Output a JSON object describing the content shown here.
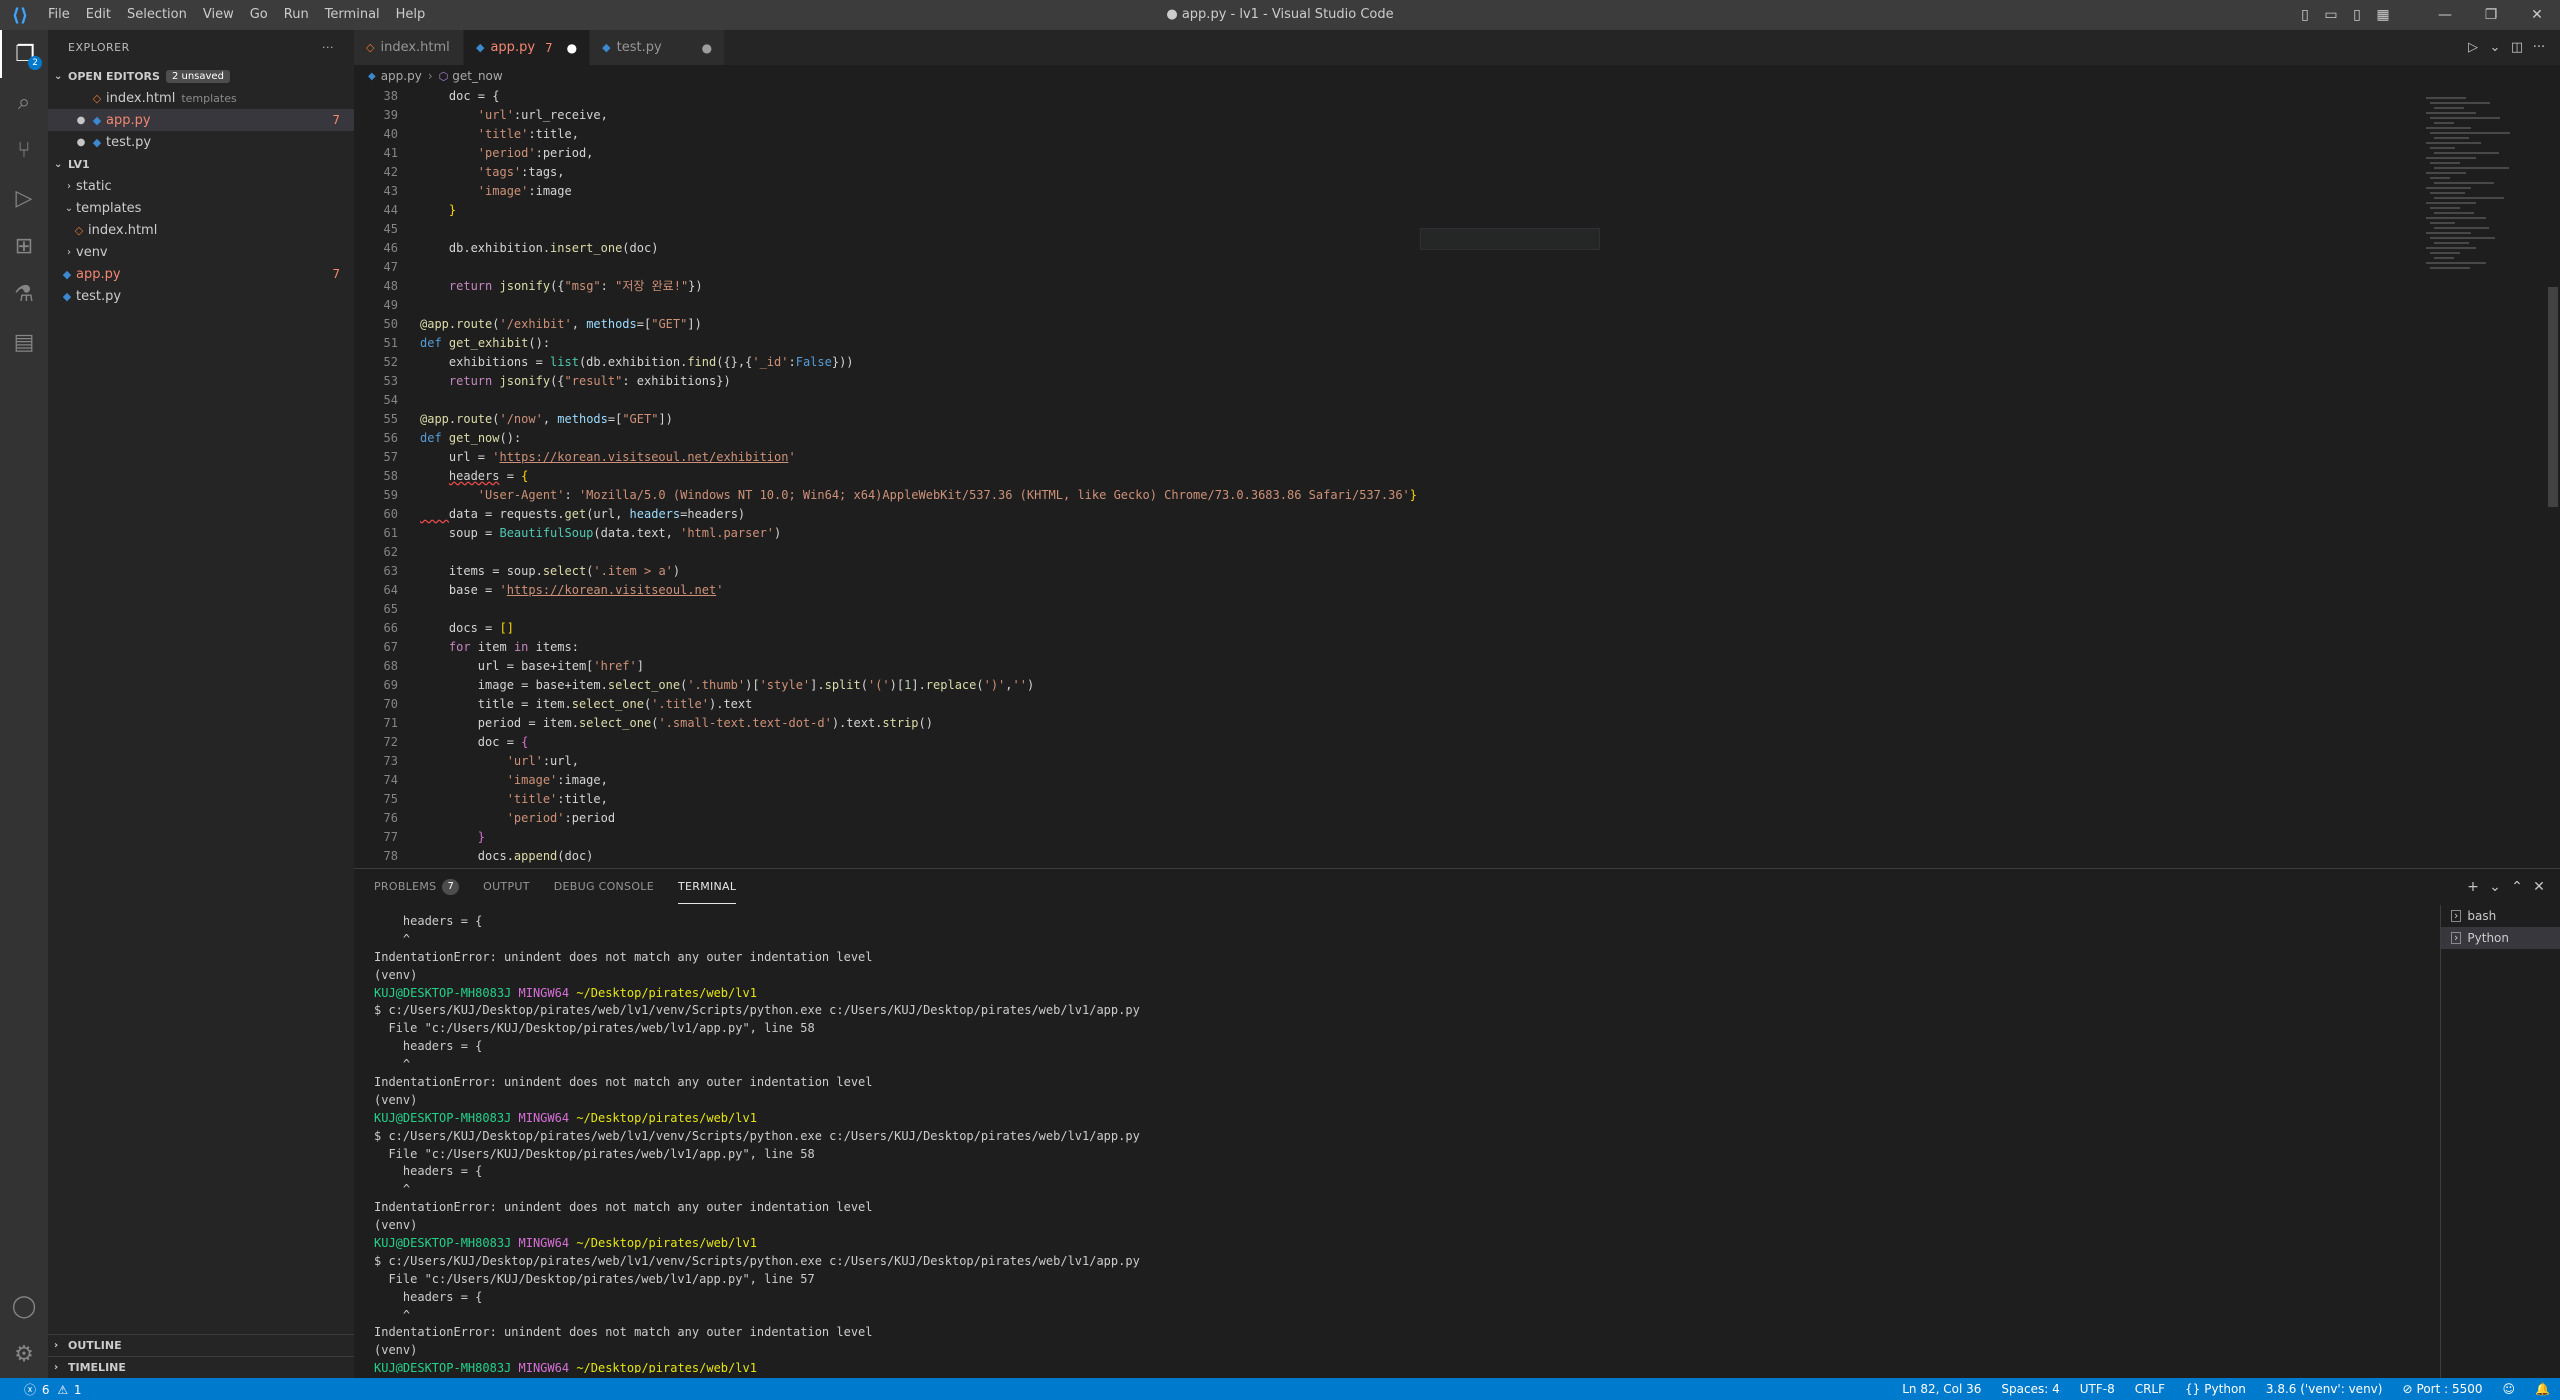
{
  "window": {
    "title": "● app.py - lv1 - Visual Studio Code",
    "menu": [
      "File",
      "Edit",
      "Selection",
      "View",
      "Go",
      "Run",
      "Terminal",
      "Help"
    ]
  },
  "activity_bar": {
    "explorer_badge": "2"
  },
  "sidebar": {
    "title": "EXPLORER",
    "open_editors": {
      "label": "OPEN EDITORS",
      "unsaved": "2 unsaved",
      "items": [
        {
          "name": "index.html",
          "desc": "templates",
          "count": ""
        },
        {
          "name": "app.py",
          "desc": "",
          "count": "7"
        },
        {
          "name": "test.py",
          "desc": "",
          "count": ""
        }
      ]
    },
    "folder": {
      "label": "LV1",
      "items": [
        {
          "name": "static",
          "count": ""
        },
        {
          "name": "templates",
          "count": ""
        },
        {
          "name": "index.html",
          "count": ""
        },
        {
          "name": "venv",
          "count": ""
        },
        {
          "name": "app.py",
          "count": "7"
        },
        {
          "name": "test.py",
          "count": ""
        }
      ]
    },
    "outline": "OUTLINE",
    "timeline": "TIMELINE"
  },
  "tabs": [
    {
      "label": "index.html",
      "count": ""
    },
    {
      "label": "app.py",
      "count": "7"
    },
    {
      "label": "test.py",
      "count": ""
    }
  ],
  "breadcrumb": {
    "file": "app.py",
    "symbol": "get_now"
  },
  "editor": {
    "line_numbers": [
      "38",
      "39",
      "40",
      "41",
      "42",
      "43",
      "44",
      "45",
      "46",
      "47",
      "48",
      "49",
      "50",
      "51",
      "52",
      "53",
      "54",
      "55",
      "56",
      "57",
      "58",
      "59",
      "60",
      "61",
      "62",
      "63",
      "64",
      "65",
      "66",
      "67",
      "68",
      "69",
      "70",
      "71",
      "72",
      "73",
      "74",
      "75",
      "76",
      "77",
      "78"
    ]
  },
  "panel": {
    "tabs": [
      {
        "label": "PROBLEMS",
        "badge": "7"
      },
      {
        "label": "OUTPUT",
        "badge": ""
      },
      {
        "label": "DEBUG CONSOLE",
        "badge": ""
      },
      {
        "label": "TERMINAL",
        "badge": ""
      }
    ],
    "terminals": [
      "bash",
      "Python"
    ],
    "terminal_lines": [
      "    headers = {",
      "    ^",
      "IndentationError: unindent does not match any outer indentation level",
      "(venv)",
      "KUJ@DESKTOP-MH8083J MINGW64 ~/Desktop/pirates/web/lv1",
      "$ c:/Users/KUJ/Desktop/pirates/web/lv1/venv/Scripts/python.exe c:/Users/KUJ/Desktop/pirates/web/lv1/app.py",
      "  File \"c:/Users/KUJ/Desktop/pirates/web/lv1/app.py\", line 58",
      "    headers = {",
      "    ^",
      "IndentationError: unindent does not match any outer indentation level",
      "(venv)",
      "KUJ@DESKTOP-MH8083J MINGW64 ~/Desktop/pirates/web/lv1",
      "$ c:/Users/KUJ/Desktop/pirates/web/lv1/venv/Scripts/python.exe c:/Users/KUJ/Desktop/pirates/web/lv1/app.py",
      "  File \"c:/Users/KUJ/Desktop/pirates/web/lv1/app.py\", line 58",
      "    headers = {",
      "    ^",
      "IndentationError: unindent does not match any outer indentation level",
      "(venv)",
      "KUJ@DESKTOP-MH8083J MINGW64 ~/Desktop/pirates/web/lv1",
      "$ c:/Users/KUJ/Desktop/pirates/web/lv1/venv/Scripts/python.exe c:/Users/KUJ/Desktop/pirates/web/lv1/app.py",
      "  File \"c:/Users/KUJ/Desktop/pirates/web/lv1/app.py\", line 57",
      "    headers = {",
      "    ^",
      "IndentationError: unindent does not match any outer indentation level",
      "(venv)",
      "KUJ@DESKTOP-MH8083J MINGW64 ~/Desktop/pirates/web/lv1",
      "$ "
    ]
  },
  "statusbar": {
    "errors": "6",
    "warnings": "1",
    "position": "Ln 82, Col 36",
    "spaces": "Spaces: 4",
    "encoding": "UTF-8",
    "eol": "CRLF",
    "language": "Python",
    "interpreter": "3.8.6 ('venv': venv)",
    "port": "Port : 5500"
  },
  "colors": {
    "accent": "#007acc",
    "error": "#f48771",
    "sidebar_bg": "#252526",
    "editor_bg": "#1e1e1e"
  }
}
